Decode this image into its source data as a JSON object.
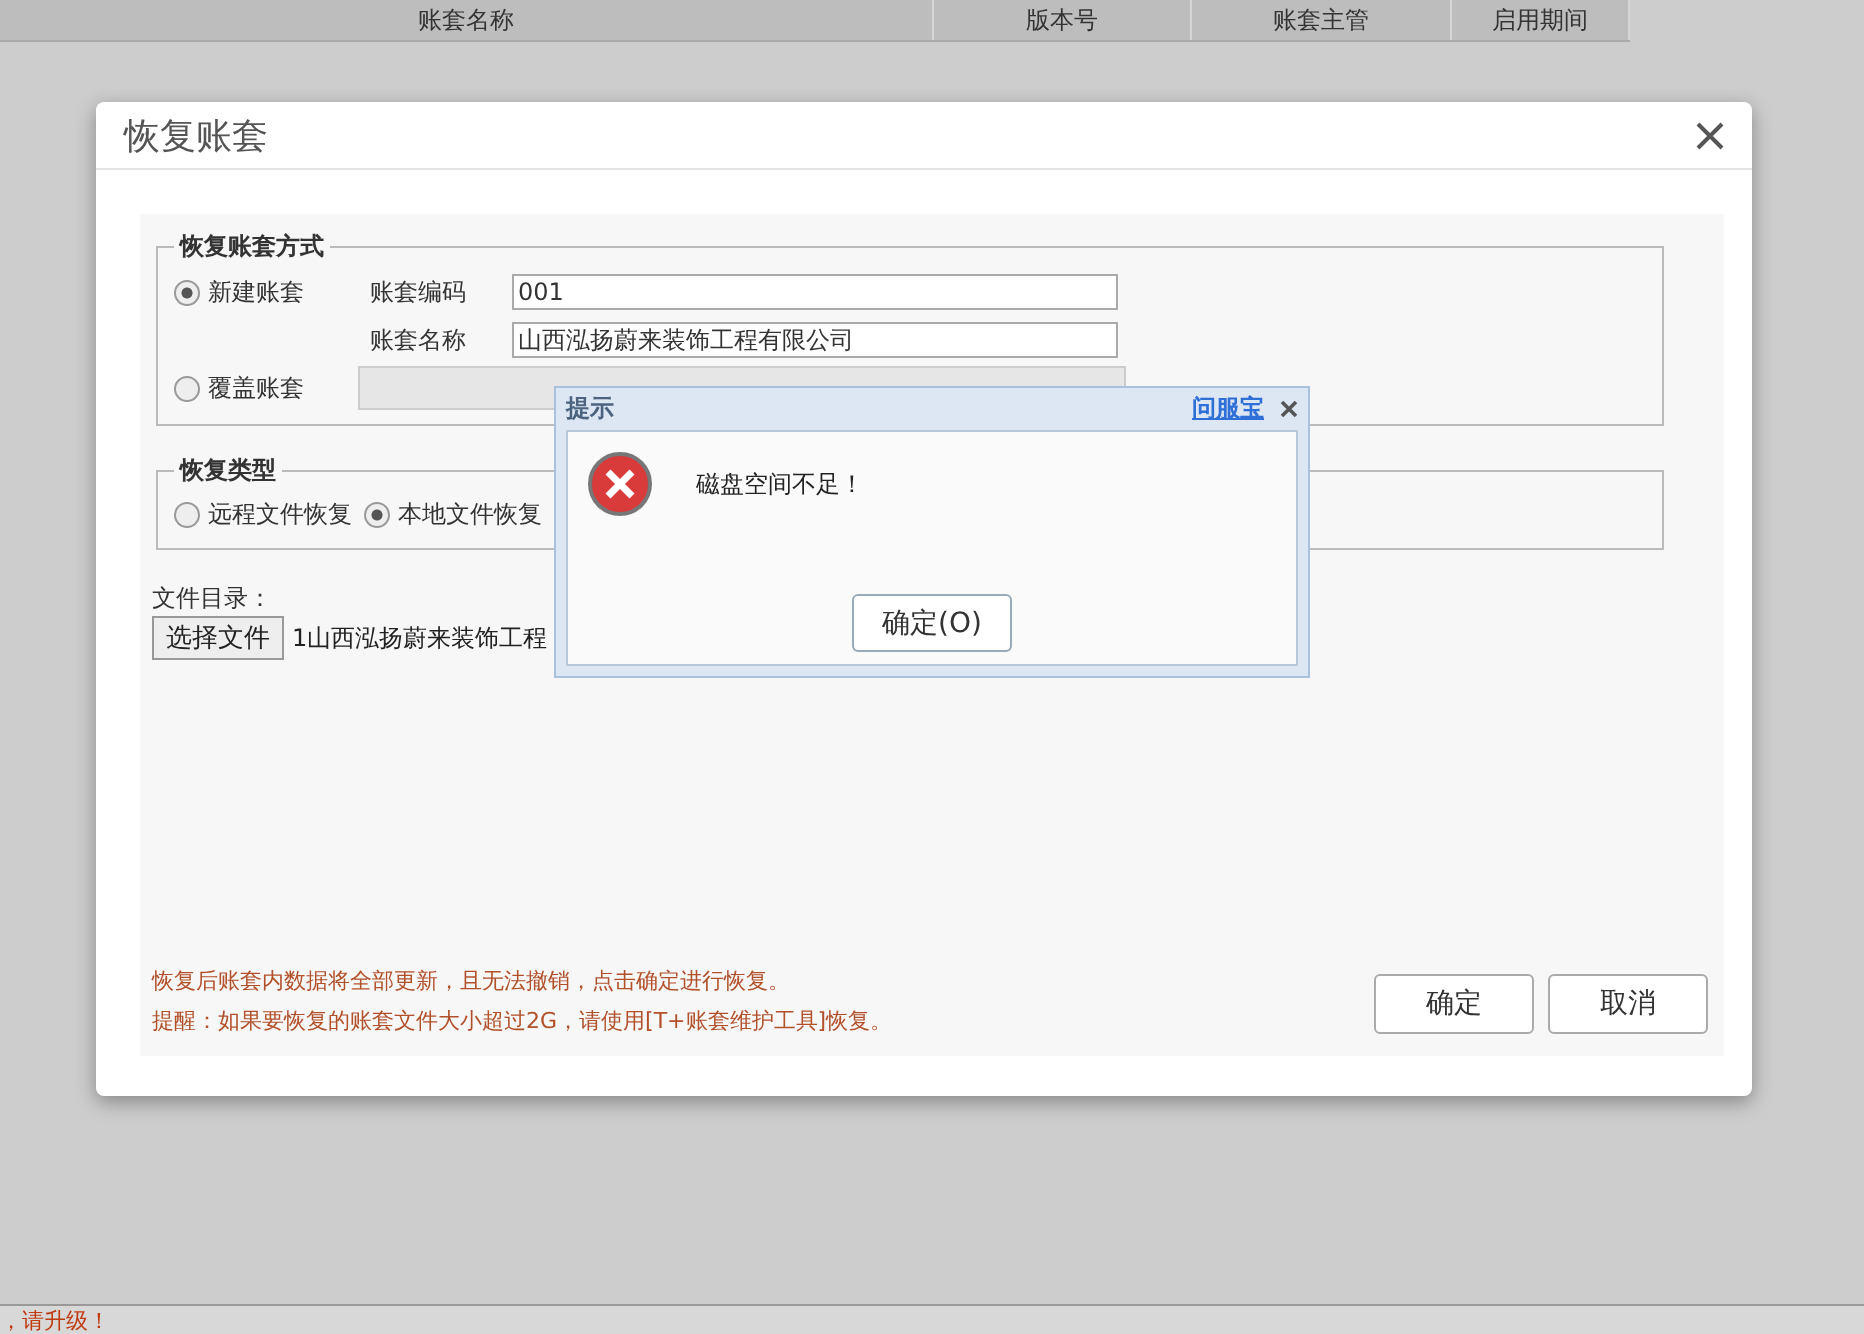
{
  "table_header": {
    "columns": [
      "账套名称",
      "版本号",
      "账套主管",
      "启用期间"
    ]
  },
  "dialog": {
    "title": "恢复账套",
    "method_group": {
      "legend": "恢复账套方式",
      "options": [
        {
          "label": "新建账套",
          "selected": true
        },
        {
          "label": "覆盖账套",
          "selected": false
        }
      ],
      "fields": [
        {
          "label": "账套编码",
          "value": "001"
        },
        {
          "label": "账套名称",
          "value": "山西泓扬蔚来装饰工程有限公司"
        }
      ]
    },
    "type_group": {
      "legend": "恢复类型",
      "options": [
        {
          "label": "远程文件恢复",
          "selected": false
        },
        {
          "label": "本地文件恢复",
          "selected": true
        }
      ]
    },
    "file": {
      "label": "文件目录：",
      "button": "选择文件",
      "value": "1山西泓扬蔚来装饰工程"
    },
    "notes": [
      "恢复后账套内数据将全部更新，且无法撤销，点击确定进行恢复。",
      "提醒：如果要恢复的账套文件大小超过2G，请使用[T+账套维护工具]恢复。"
    ],
    "buttons": [
      "确定",
      "取消"
    ]
  },
  "alert": {
    "title": "提示",
    "link": "问服宝",
    "message": "磁盘空间不足！",
    "button": "确定(O)"
  },
  "status_text": "，请升级！"
}
